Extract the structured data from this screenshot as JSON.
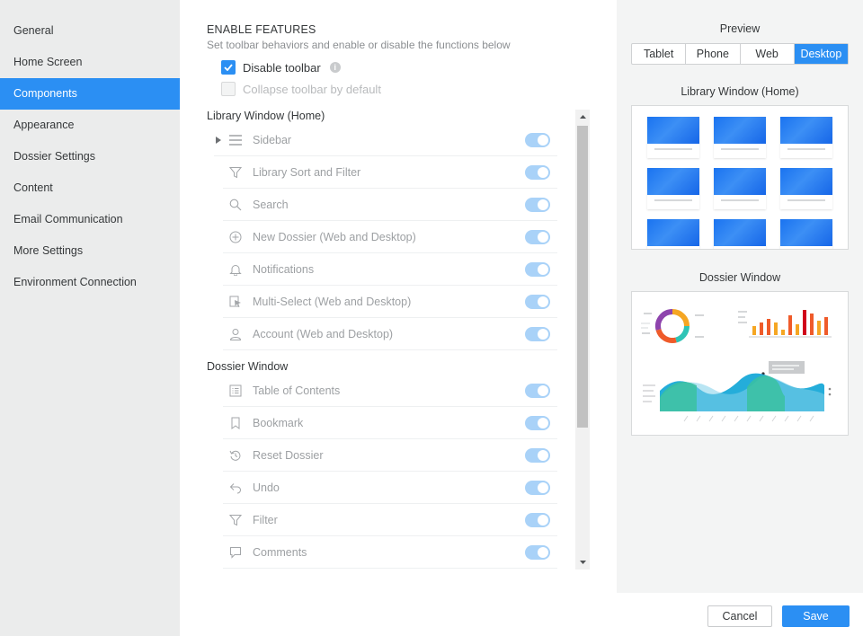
{
  "sidebar": {
    "items": [
      {
        "label": "General",
        "active": false
      },
      {
        "label": "Home Screen",
        "active": false
      },
      {
        "label": "Components",
        "active": true
      },
      {
        "label": "Appearance",
        "active": false
      },
      {
        "label": "Dossier Settings",
        "active": false
      },
      {
        "label": "Content",
        "active": false
      },
      {
        "label": "Email Communication",
        "active": false
      },
      {
        "label": "More Settings",
        "active": false
      },
      {
        "label": "Environment Connection",
        "active": false
      }
    ]
  },
  "main": {
    "section_title": "ENABLE FEATURES",
    "section_desc": "Set toolbar behaviors and enable or disable the functions below",
    "disable_toolbar": {
      "label": "Disable toolbar",
      "checked": true
    },
    "collapse_toolbar": {
      "label": "Collapse toolbar by default",
      "checked": false,
      "disabled": true
    },
    "library_group": {
      "title": "Library Window (Home)",
      "items": [
        {
          "label": "Sidebar",
          "icon": "menu-icon",
          "expandable": true
        },
        {
          "label": "Library Sort and Filter",
          "icon": "filter-icon"
        },
        {
          "label": "Search",
          "icon": "search-icon"
        },
        {
          "label": "New Dossier (Web and Desktop)",
          "icon": "add-circle-icon"
        },
        {
          "label": "Notifications",
          "icon": "bell-icon"
        },
        {
          "label": "Multi-Select (Web and Desktop)",
          "icon": "multi-select-icon"
        },
        {
          "label": "Account (Web and Desktop)",
          "icon": "user-icon"
        }
      ]
    },
    "dossier_group": {
      "title": "Dossier Window",
      "items": [
        {
          "label": "Table of Contents",
          "icon": "toc-icon"
        },
        {
          "label": "Bookmark",
          "icon": "bookmark-icon"
        },
        {
          "label": "Reset Dossier",
          "icon": "reset-icon"
        },
        {
          "label": "Undo",
          "icon": "undo-icon"
        },
        {
          "label": "Filter",
          "icon": "filter-icon"
        },
        {
          "label": "Comments",
          "icon": "comment-icon"
        }
      ]
    }
  },
  "preview": {
    "title": "Preview",
    "tabs": [
      {
        "label": "Tablet",
        "active": false
      },
      {
        "label": "Phone",
        "active": false
      },
      {
        "label": "Web",
        "active": false
      },
      {
        "label": "Desktop",
        "active": true
      }
    ],
    "library_title": "Library Window (Home)",
    "dossier_title": "Dossier Window"
  },
  "footer": {
    "cancel_label": "Cancel",
    "save_label": "Save"
  },
  "colors": {
    "accent": "#2b8ff3",
    "toggle_on_disabled": "#a9d2f8",
    "sidebar_bg": "#ebecec",
    "preview_bg": "#f3f4f4"
  }
}
